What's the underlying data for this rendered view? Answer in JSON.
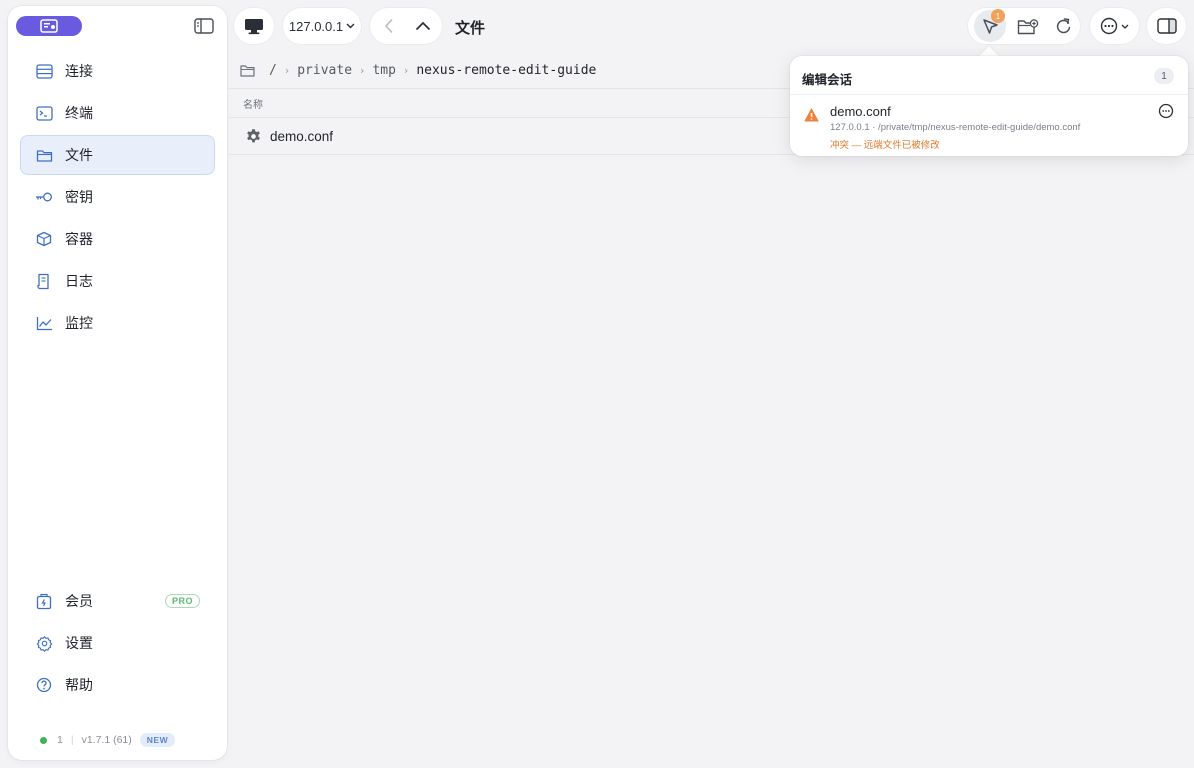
{
  "sidebar": {
    "items": [
      {
        "label": "连接",
        "icon": "server-icon"
      },
      {
        "label": "终端",
        "icon": "terminal-icon"
      },
      {
        "label": "文件",
        "icon": "folder-icon",
        "active": true
      },
      {
        "label": "密钥",
        "icon": "key-icon"
      },
      {
        "label": "容器",
        "icon": "box-icon"
      },
      {
        "label": "日志",
        "icon": "log-icon"
      },
      {
        "label": "监控",
        "icon": "chart-icon"
      }
    ],
    "bottom": [
      {
        "label": "会员",
        "icon": "membership-icon",
        "badge": "PRO"
      },
      {
        "label": "设置",
        "icon": "gear-icon"
      },
      {
        "label": "帮助",
        "icon": "help-icon"
      }
    ],
    "status": {
      "connections": "1",
      "version": "v1.7.1 (61)",
      "badge": "NEW"
    }
  },
  "toolbar": {
    "host": "127.0.0.1",
    "title": "文件",
    "notification_count": "1"
  },
  "breadcrumb": {
    "root": "/",
    "parts": [
      "private",
      "tmp",
      "nexus-remote-edit-guide"
    ]
  },
  "table": {
    "columns": [
      "名称"
    ],
    "rows": [
      {
        "name": "demo.conf",
        "icon": "gear-icon"
      }
    ]
  },
  "popover": {
    "title": "编辑会话",
    "count": "1",
    "item": {
      "name": "demo.conf",
      "path": "127.0.0.1 · /private/tmp/nexus-remote-edit-guide/demo.conf",
      "status": "冲突 — 远端文件已被修改"
    }
  },
  "colors": {
    "accent": "#6a5ae0",
    "active_bg": "#e8effb",
    "warning": "#e07a2e",
    "online": "#3eb35b"
  }
}
